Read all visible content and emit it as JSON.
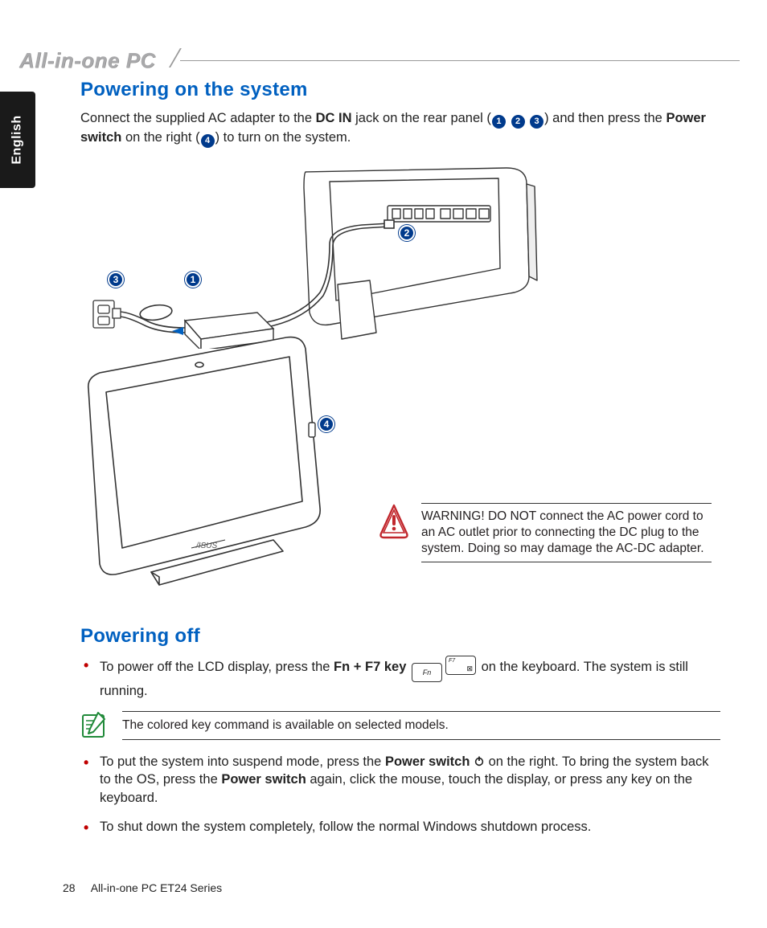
{
  "header": {
    "title": "All-in-one PC"
  },
  "side_tab": {
    "label": "English"
  },
  "section1": {
    "heading": "Powering on the system",
    "intro_pre": "Connect the supplied AC adapter to the ",
    "intro_bold1": "DC IN",
    "intro_mid1": " jack on the rear panel (",
    "intro_mid2": ") and then press the ",
    "intro_bold2": "Power switch",
    "intro_mid3": " on the right (",
    "intro_end": ") to turn on the system.",
    "callouts": {
      "c1": "1",
      "c2": "2",
      "c3": "3",
      "c4": "4"
    },
    "warning": "WARNING! DO NOT connect the AC power cord to an AC outlet prior to connecting the DC plug to the system. Doing so may damage the AC-DC adapter."
  },
  "section2": {
    "heading": "Powering off",
    "bullet1_pre": "To power off the LCD display, press the ",
    "bullet1_bold": "Fn + F7 key",
    "bullet1_post": " on the keyboard. The system is still running.",
    "key_fn": "Fn",
    "key_f7": "F7",
    "note": "The colored key command is available on selected models.",
    "bullet2_pre": "To put the system into suspend mode, press the ",
    "bullet2_bold1": "Power switch",
    "bullet2_mid": " on the right. To bring the system back to the OS, press the ",
    "bullet2_bold2": "Power switch",
    "bullet2_post": " again, click the mouse, touch the display, or press any key on the keyboard.",
    "bullet3": "To shut down the system completely, follow the normal Windows shutdown process."
  },
  "footer": {
    "page": "28",
    "label": "All-in-one PC ET24 Series"
  }
}
